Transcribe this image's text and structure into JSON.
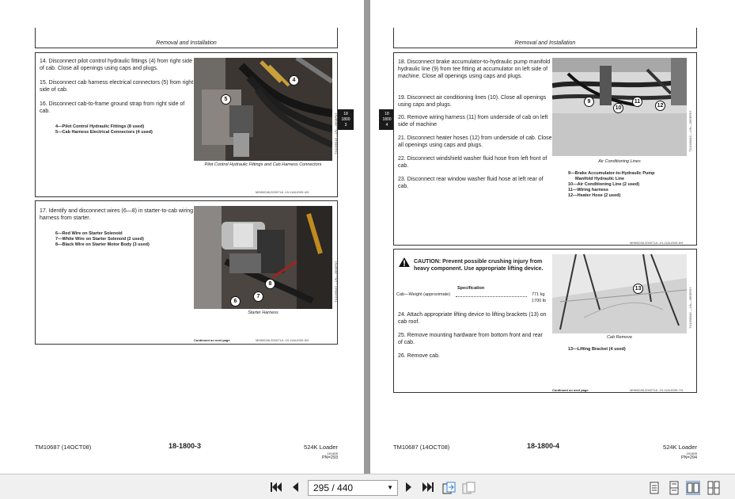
{
  "left_page": {
    "header": "Removal and Installation",
    "section1": {
      "steps": [
        "14. Disconnect pilot control hydraulic fittings (4) from right side of cab. Close all openings using caps and plugs.",
        "15. Disconnect cab harness electrical connectors (5) from right side of cab.",
        "16. Disconnect cab-to-frame ground strap from right side of cab."
      ],
      "legend": [
        "4—Pilot Control Hydraulic Fittings (8 used)",
        "5—Cab Harness Electrical Connectors (4 used)"
      ],
      "callouts": [
        "4",
        "5"
      ],
      "caption": "Pilot Control Hydraulic Fittings and Cab Harness Connectors",
      "figure_code": "TX1036018 —UN—28SEP07",
      "footer_code": "MH86C66,000071A -19-11AUG09-4/9"
    },
    "section2": {
      "steps": [
        "17. Identify and disconnect wires (6—8) in starter-to-cab wiring harness from starter."
      ],
      "legend": [
        "6—Red Wire on Starter Solenoid",
        "7—White Wire on Starter Solenoid (2 used)",
        "8—Black Wire on Starter Motor Body (3 used)"
      ],
      "callouts": [
        "6",
        "7",
        "8"
      ],
      "caption": "Starter Harness",
      "figure_code": "TX1036043 —UN—28SEP07",
      "continued": "Continued on next page",
      "footer_code": "MH86C66,000071A -19-11AUG09-5/9"
    },
    "tab": [
      "18",
      "1800",
      "3"
    ],
    "footer": {
      "left": "TM10687 (14OCT08)",
      "center": "18-1800-3",
      "right": "524K Loader",
      "small1": "101409",
      "small2": "PN=293"
    }
  },
  "right_page": {
    "header": "Removal and Installation",
    "section1": {
      "steps": [
        "18. Disconnect brake accumulator-to-hydraulic pump manifold hydraulic line (9) from tee fitting at accumulator on left side of machine. Close all openings using caps and plugs.",
        "19. Disconnect air conditioning lines (10). Close all openings using caps and plugs.",
        "20. Remove wiring harness (11) from underside of cab on left side of machine",
        "21. Disconnect heater hoses (12) from underside of cab. Close all openings using caps and plugs.",
        "22. Disconnect windshield washer fluid hose from left front of cab.",
        "23. Disconnect rear window washer fluid hose at left rear of cab."
      ],
      "legend": [
        "9—Brake Accumulator-to-Hydraulic Pump",
        "Manifold Hydraulic Line",
        "10—Air Conditioning Line (2 used)",
        "11—Wiring harness",
        "12—Heater Hose (2 used)"
      ],
      "callouts": [
        "9",
        "10",
        "11",
        "12"
      ],
      "caption": "Air Conditioning Lines",
      "figure_code": "TX1036044 —UN—28SEP07",
      "footer_code": "MH86C66,000071A -19-11AUG09-6/9"
    },
    "section2": {
      "caution": "CAUTION: Prevent possible crushing injury from heavy component. Use appropriate lifting device.",
      "spec_title": "Specification",
      "spec_label": "Cab—Weight (approximate)",
      "spec_value1": "771 kg",
      "spec_value2": "1700 lb",
      "steps": [
        "24. Attach appropriate lifting device to lifting brackets (13) on cab roof.",
        "25. Remove mounting hardware from bottom front and rear of cab.",
        "26. Remove cab."
      ],
      "legend": [
        "13—Lifting Bracket (4 used)"
      ],
      "callouts": [
        "13"
      ],
      "caption": "Cab Remove",
      "figure_code": "TX1036045 —UN—28SEP07",
      "continued": "Continued on next page",
      "footer_code": "MH86C66,000071A -19-11AUG09-7/9"
    },
    "tab": [
      "18",
      "1800",
      "4"
    ],
    "footer": {
      "left": "TM10687 (14OCT08)",
      "center": "18-1800-4",
      "right": "524K Loader",
      "small1": "101409",
      "small2": "PN=294"
    }
  },
  "toolbar": {
    "first_page_icon": "first-page-icon",
    "prev_page_icon": "prev-page-icon",
    "page_indicator": "295 / 440",
    "next_page_icon": "next-page-icon",
    "last_page_icon": "last-page-icon",
    "colors": {
      "bar": "#f0f0f0",
      "active_view": "#c5d5ea"
    }
  }
}
